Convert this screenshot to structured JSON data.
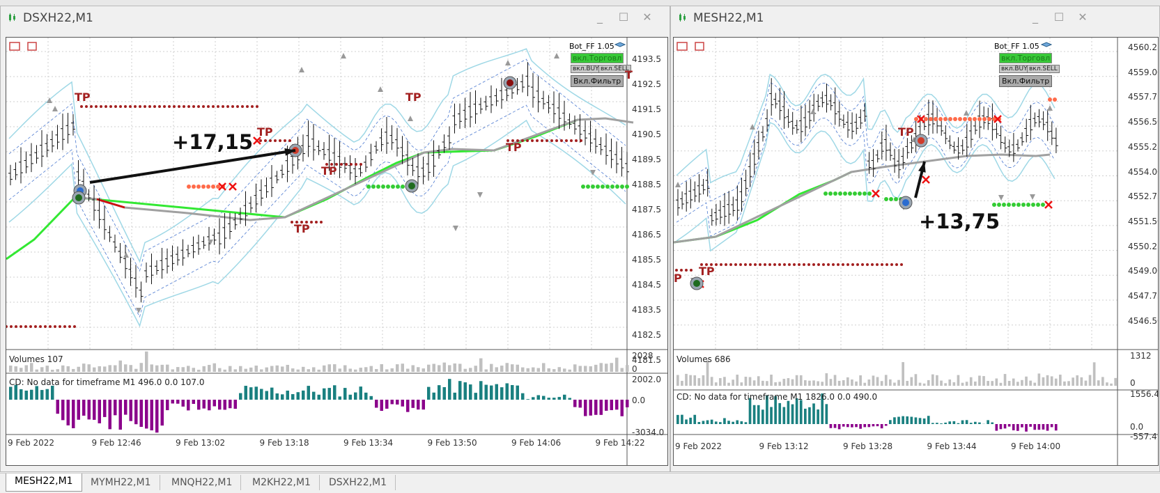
{
  "windows": {
    "left": {
      "title": "DSXH22,M1",
      "bot_label": "Bot_FF 1.05",
      "btn_trade": "вкл.Торговл",
      "btn_buy": "вкл.BUY",
      "btn_sell": "вкл.SELL",
      "btn_filter": "Вкл.Фильтр",
      "price_labels": [
        "4193.5",
        "4192.5",
        "4191.5",
        "4190.5",
        "4189.5",
        "4188.5",
        "4187.5",
        "4186.5",
        "4185.5",
        "4184.5",
        "4183.5",
        "4182.5",
        "4181.5"
      ],
      "volumes_label": "Volumes 107",
      "volumes_scale": [
        "2028",
        "0"
      ],
      "cd_label": "CD: No data for timeframe M1 496.0 0.0 107.0",
      "cd_scale": [
        "2002.0",
        "0.0",
        "-3034.0"
      ],
      "time_labels": [
        "9 Feb 2022",
        "9 Feb 12:46",
        "9 Feb 13:02",
        "9 Feb 13:18",
        "9 Feb 13:34",
        "9 Feb 13:50",
        "9 Feb 14:06",
        "9 Feb 14:22"
      ],
      "profit": "+17,15",
      "tp": "TP",
      "tp_partial": "T"
    },
    "right": {
      "title": "MESH22,M1",
      "bot_label": "Bot_FF 1.05",
      "btn_trade": "вкл.Торговл",
      "btn_buy": "вкл.BUY",
      "btn_sell": "вкл.SELL",
      "btn_filter": "Вкл.Фильтр",
      "price_labels": [
        "4560.25",
        "4559.00",
        "4557.75",
        "4556.50",
        "4555.25",
        "4554.00",
        "4552.75",
        "4551.50",
        "4550.25",
        "4549.00",
        "4547.75",
        "4546.50"
      ],
      "volumes_label": "Volumes 686",
      "volumes_scale": [
        "1312",
        "0"
      ],
      "cd_label": "CD: No data for timeframe M1 1826.0 0.0 490.0",
      "cd_scale": [
        "1556.4",
        "0.0",
        "-557.4"
      ],
      "time_labels": [
        "9 Feb 2022",
        "9 Feb 13:12",
        "9 Feb 13:28",
        "9 Feb 13:44",
        "9 Feb 14:00"
      ],
      "profit": "+13,75",
      "tp": "TP",
      "tp_partial": "P"
    }
  },
  "tabs": [
    "MESH22,M1",
    "MYMH22,M1",
    "MNQH22,M1",
    "M2KH22,M1",
    "DSXH22,M1"
  ],
  "window_buttons": {
    "minimize": "_",
    "maximize": "☐",
    "close": "✕"
  },
  "colors": {
    "bollinger": "#9fd8e6",
    "ma_up": "#33e833",
    "ma_down": "#cc1111",
    "ma_flat": "#a0a0a0",
    "tp_dots": "#a32020",
    "green_dots": "#33cc33",
    "cd_positive": "#1a8080",
    "cd_negative": "#8b008b",
    "volume": "#c0c0c0"
  }
}
